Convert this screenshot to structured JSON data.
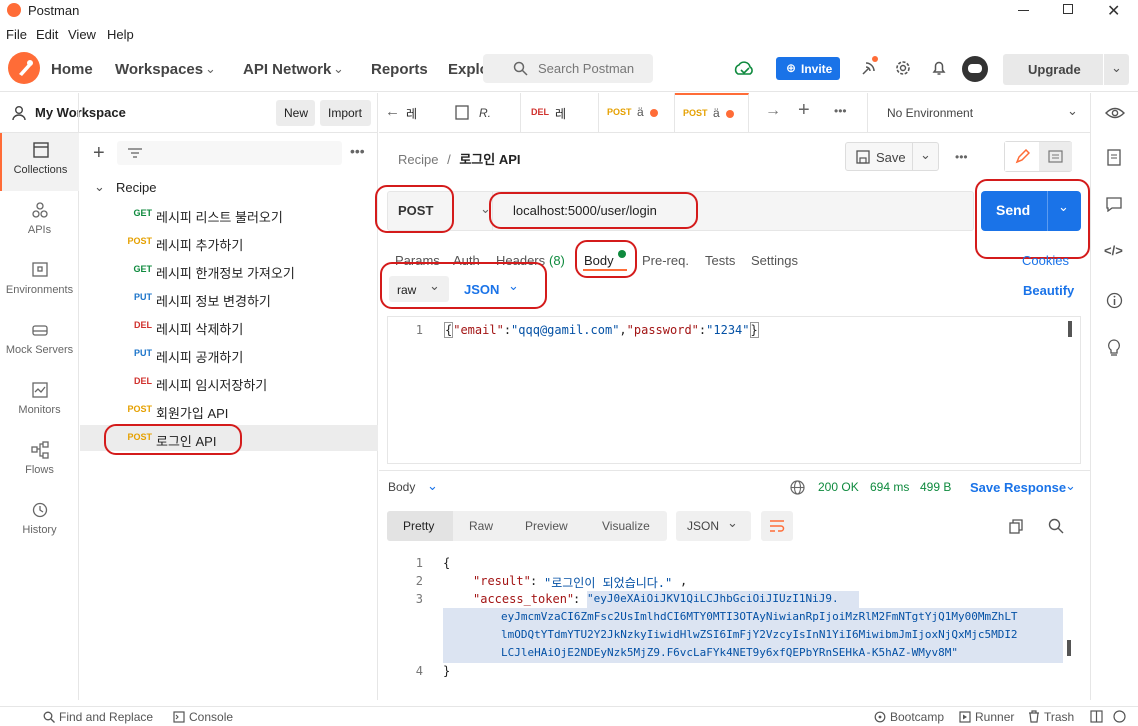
{
  "window": {
    "title": "Postman"
  },
  "menu": [
    "File",
    "Edit",
    "View",
    "Help"
  ],
  "header": {
    "nav": [
      "Home",
      "Workspaces",
      "API Network",
      "Reports",
      "Explo"
    ],
    "search_placeholder": "Search Postman",
    "invite_label": "Invite",
    "upgrade_label": "Upgrade"
  },
  "workspace": {
    "name": "My Workspace",
    "new_label": "New",
    "import_label": "Import"
  },
  "rail": [
    "Collections",
    "APIs",
    "Environments",
    "Mock Servers",
    "Monitors",
    "Flows",
    "History"
  ],
  "collection": {
    "name": "Recipe",
    "items": [
      {
        "method": "GET",
        "name": "레시피 리스트 불러오기"
      },
      {
        "method": "POST",
        "name": "레시피 추가하기"
      },
      {
        "method": "GET",
        "name": "레시피 한개정보 가져오기"
      },
      {
        "method": "PUT",
        "name": "레시피 정보 변경하기"
      },
      {
        "method": "DEL",
        "name": "레시피 삭제하기"
      },
      {
        "method": "PUT",
        "name": "레시피 공개하기"
      },
      {
        "method": "DEL",
        "name": "레시피 임시저장하기"
      },
      {
        "method": "POST",
        "name": "회원가입 API"
      },
      {
        "method": "POST",
        "name": "로그인 API"
      }
    ]
  },
  "tabs": [
    {
      "method": "",
      "label": "레"
    },
    {
      "method": "",
      "label": "R."
    },
    {
      "method": "DEL",
      "label": "레"
    },
    {
      "method": "POST",
      "label": "ä"
    },
    {
      "method": "POST",
      "label": "ä"
    }
  ],
  "environment": "No Environment",
  "breadcrumb": {
    "collection": "Recipe",
    "sep": "/",
    "request": "로그인 API"
  },
  "save_label": "Save",
  "request": {
    "method": "POST",
    "url": "localhost:5000/user/login",
    "send_label": "Send",
    "tabs": [
      "Params",
      "Auth",
      "Headers",
      "(8)",
      "Body",
      "Pre-req.",
      "Tests",
      "Settings"
    ],
    "cookies_label": "Cookies",
    "body_mode": "raw",
    "body_lang": "JSON",
    "beautify_label": "Beautify",
    "body_line_no": "1",
    "body_pre": "{",
    "body_key1": "\"email\"",
    "body_colon1": ":",
    "body_val1": "\"qqq@gamil.com\"",
    "body_comma": ",",
    "body_key2": "\"password\"",
    "body_colon2": ":",
    "body_val2": "\"1234\"",
    "body_post": "}"
  },
  "response": {
    "section_label": "Body",
    "status": "200 OK",
    "time": "694 ms",
    "size": "499 B",
    "save_label": "Save Response",
    "view_tabs": [
      "Pretty",
      "Raw",
      "Preview",
      "Visualize"
    ],
    "format": "JSON",
    "line_numbers": [
      "1",
      "2",
      "3",
      "4"
    ],
    "open_brace": "{",
    "key_result": "\"result\"",
    "val_result": "\"로그인이 되었습니다.\"",
    "key_token": "\"access_token\"",
    "token_lines": [
      "\"eyJ0eXAiOiJKV1QiLCJhbGciOiJIUzI1NiJ9.",
      "eyJmcmVzaCI6ZmFsc2UsImlhdCI6MTY0MTI3OTAyNiwianRpIjoiMzRlM2FmNTgtYjQ1My00MmZhLT",
      "lmODQtYTdmYTU2Y2JkNzkyIiwidHlwZSI6ImFjY2VzcyIsInN1YiI6MiwibmJmIjoxNjQxMjc5MDI2",
      "LCJleHAiOjE2NDEyNzk5MjZ9.F6vcLaFYk4NET9y6xfQEPbYRnSEHkA-K5hAZ-WMyv8M\""
    ],
    "close_brace": "}"
  },
  "statusbar": {
    "find_replace": "Find and Replace",
    "console": "Console",
    "bootcamp": "Bootcamp",
    "runner": "Runner",
    "trash": "Trash"
  },
  "colors": {
    "brand": "#ff6c37",
    "send": "#1a73e8",
    "annotation": "#d41b1b"
  }
}
